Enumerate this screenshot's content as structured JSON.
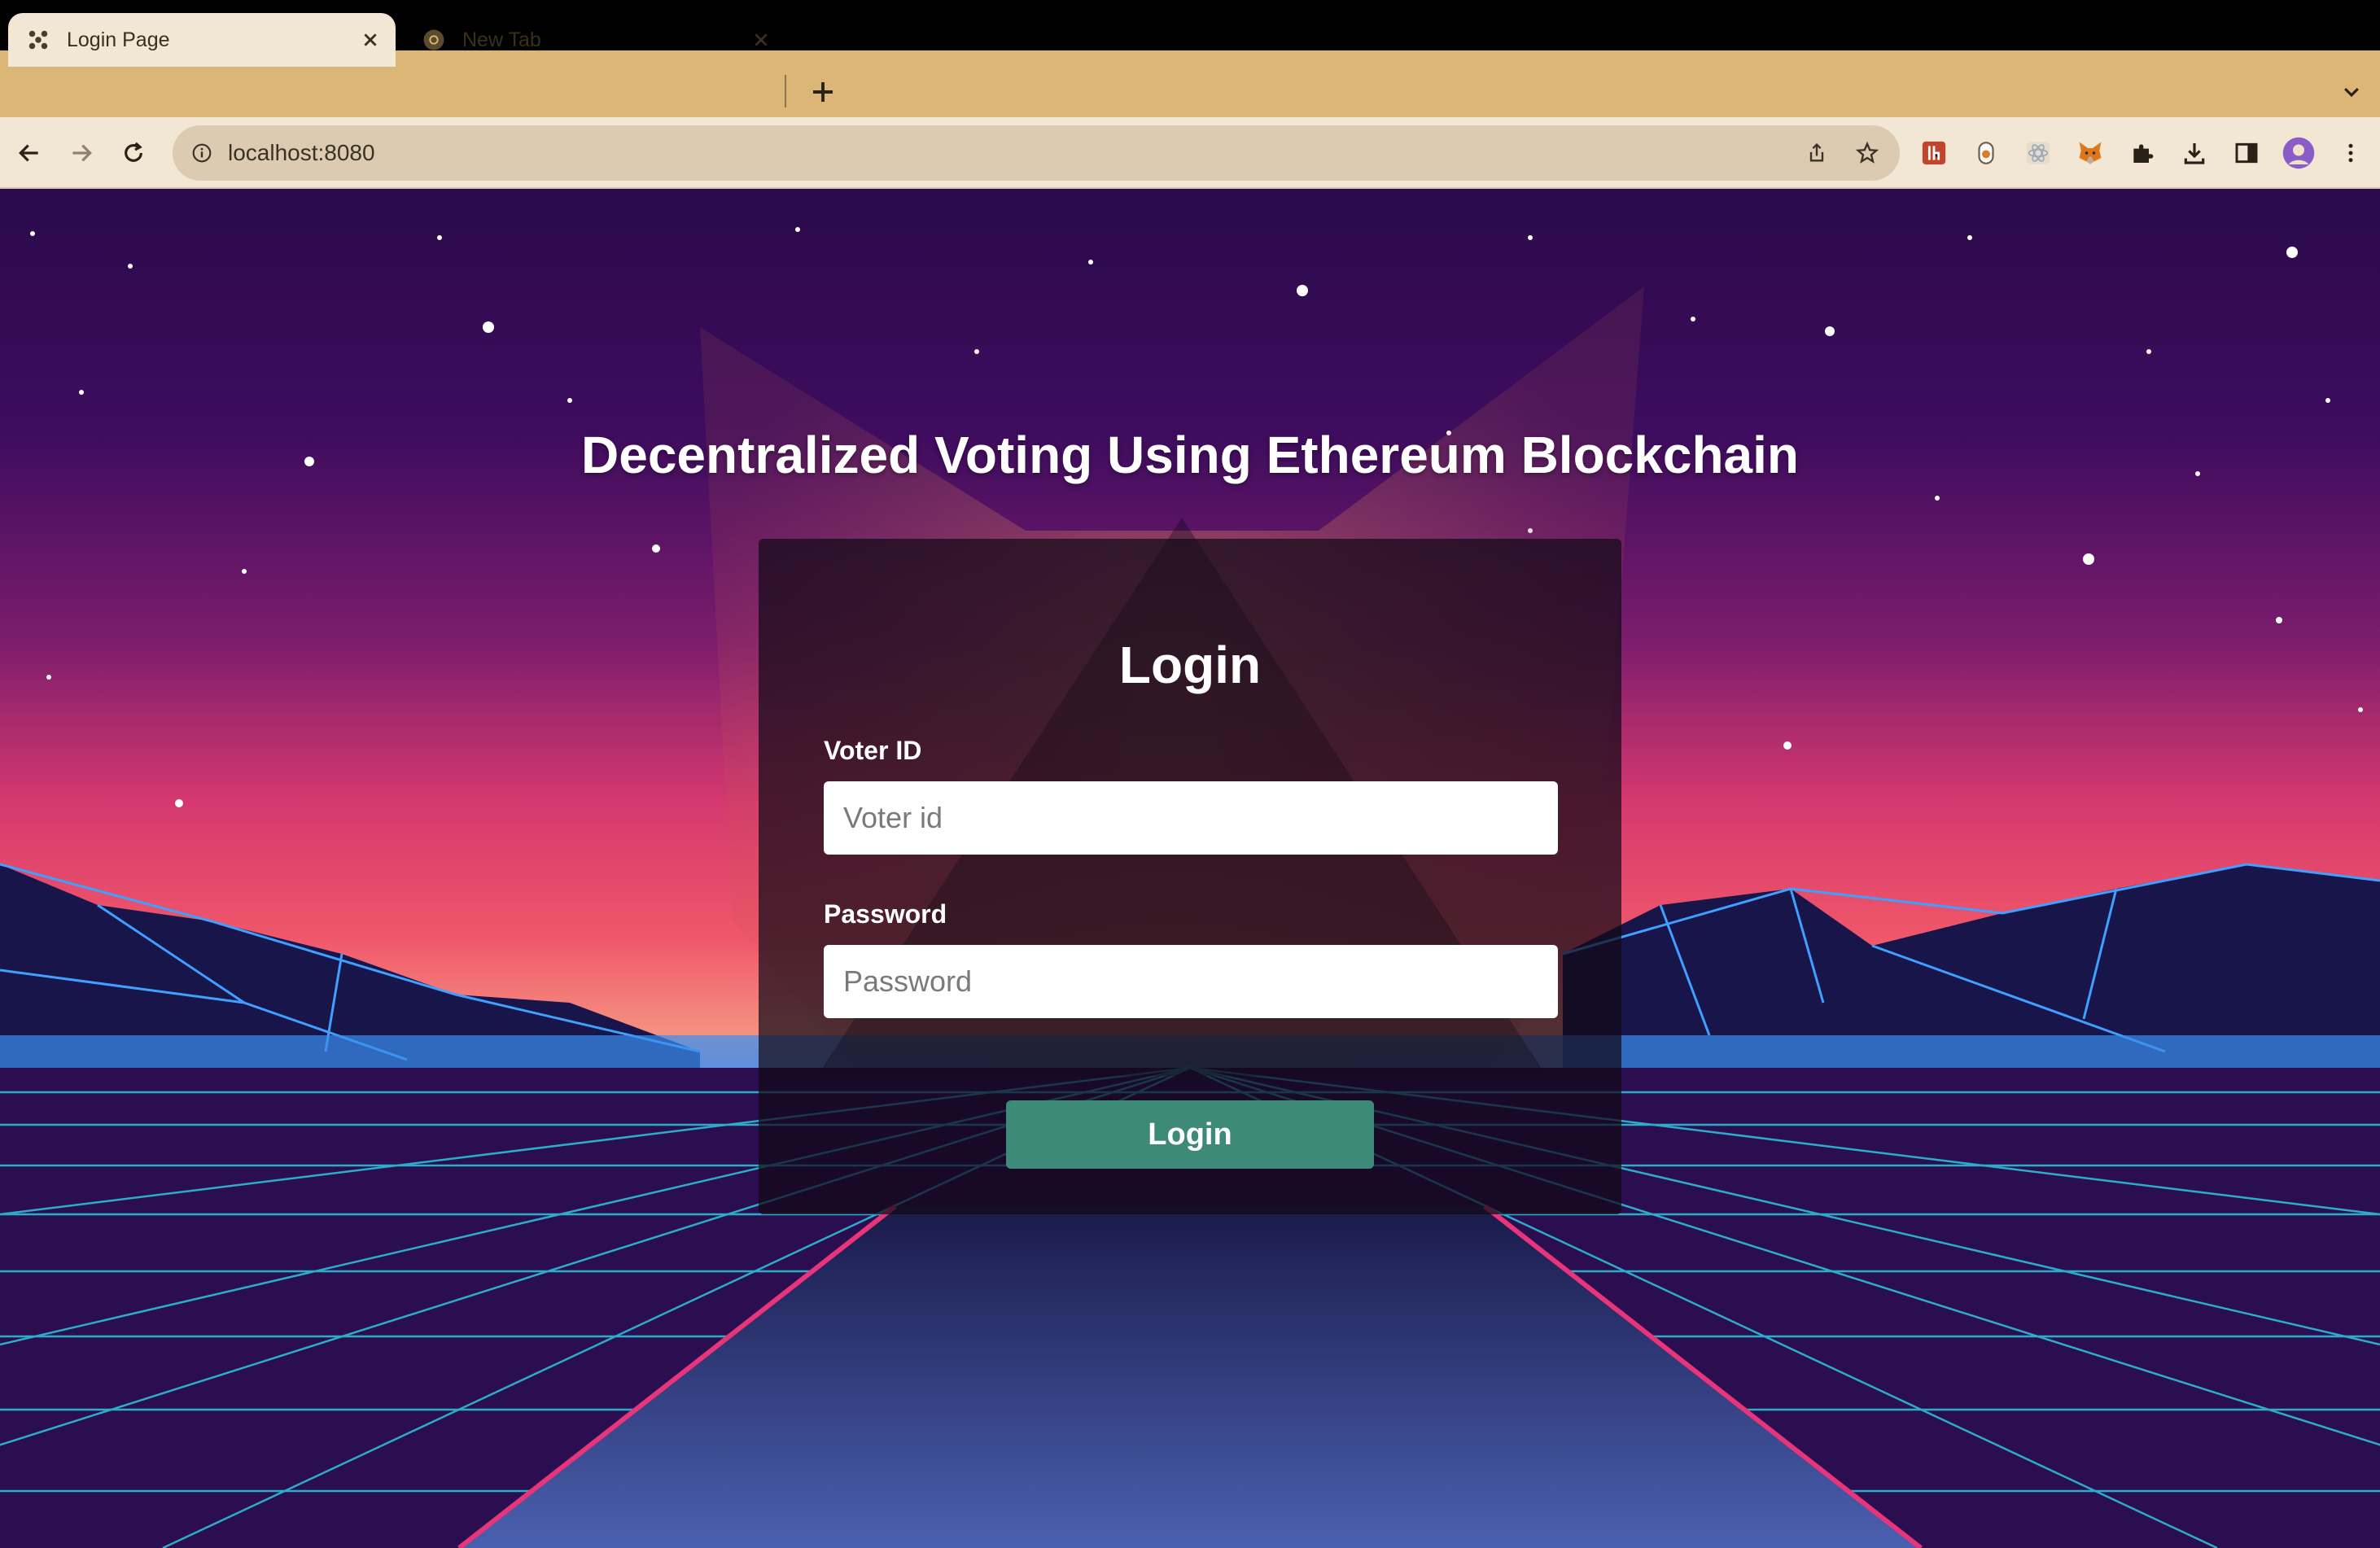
{
  "browser": {
    "tabs": [
      {
        "label": "Login Page",
        "active": true
      },
      {
        "label": "New Tab",
        "active": false
      }
    ],
    "address": "localhost:8080",
    "accent": "#dcb676",
    "extensions": [
      "red-extension-icon",
      "bulb-extension-icon",
      "react-extension-icon",
      "metamask-fox-icon",
      "puzzle-icon",
      "download-icon",
      "sidebar-icon",
      "profile-avatar",
      "more-menu-icon"
    ]
  },
  "page": {
    "heading": "Decentralized Voting Using Ethereum Blockchain",
    "login_title": "Login",
    "voter_id_label": "Voter ID",
    "voter_id_placeholder": "Voter id",
    "voter_id_value": "",
    "password_label": "Password",
    "password_placeholder": "Password",
    "password_value": "",
    "login_button": "Login",
    "button_color": "#3e8a78"
  }
}
